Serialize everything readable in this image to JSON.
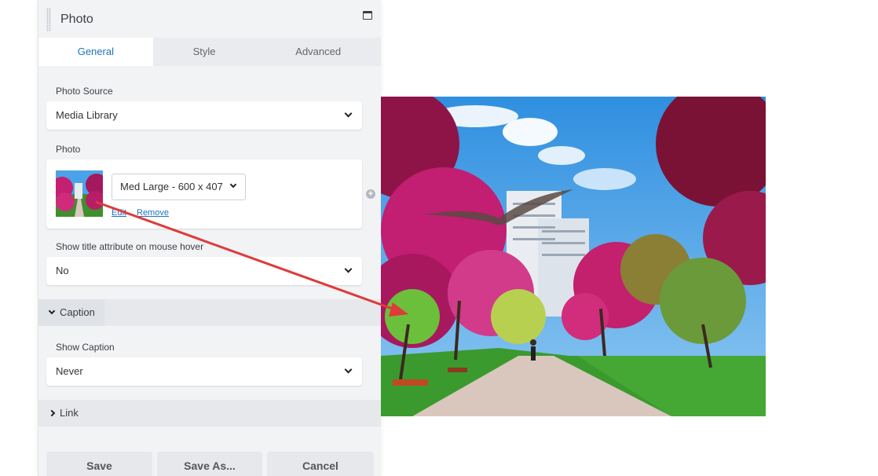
{
  "panel": {
    "title": "Photo",
    "tabs": [
      {
        "label": "General",
        "active": true
      },
      {
        "label": "Style",
        "active": false
      },
      {
        "label": "Advanced",
        "active": false
      }
    ]
  },
  "fields": {
    "photo_source": {
      "label": "Photo Source",
      "value": "Media Library"
    },
    "photo": {
      "label": "Photo",
      "size_value": "Med Large - 600 x 407",
      "edit_link": "Edit",
      "remove_link": "Remove"
    },
    "show_title": {
      "label": "Show title attribute on mouse hover",
      "value": "No"
    }
  },
  "caption_section": {
    "title": "Caption",
    "show_caption": {
      "label": "Show Caption",
      "value": "Never"
    }
  },
  "link_section": {
    "title": "Link"
  },
  "buttons": {
    "save": "Save",
    "save_as": "Save As...",
    "cancel": "Cancel"
  },
  "colors": {
    "accent": "#1e73be",
    "arrow": "#e03a3a",
    "panel_bg": "#f2f3f5"
  },
  "icons": [
    "drag-handle-icon",
    "maximize-icon",
    "chevron-down-icon",
    "chevron-right-icon",
    "plus-circle-icon"
  ]
}
